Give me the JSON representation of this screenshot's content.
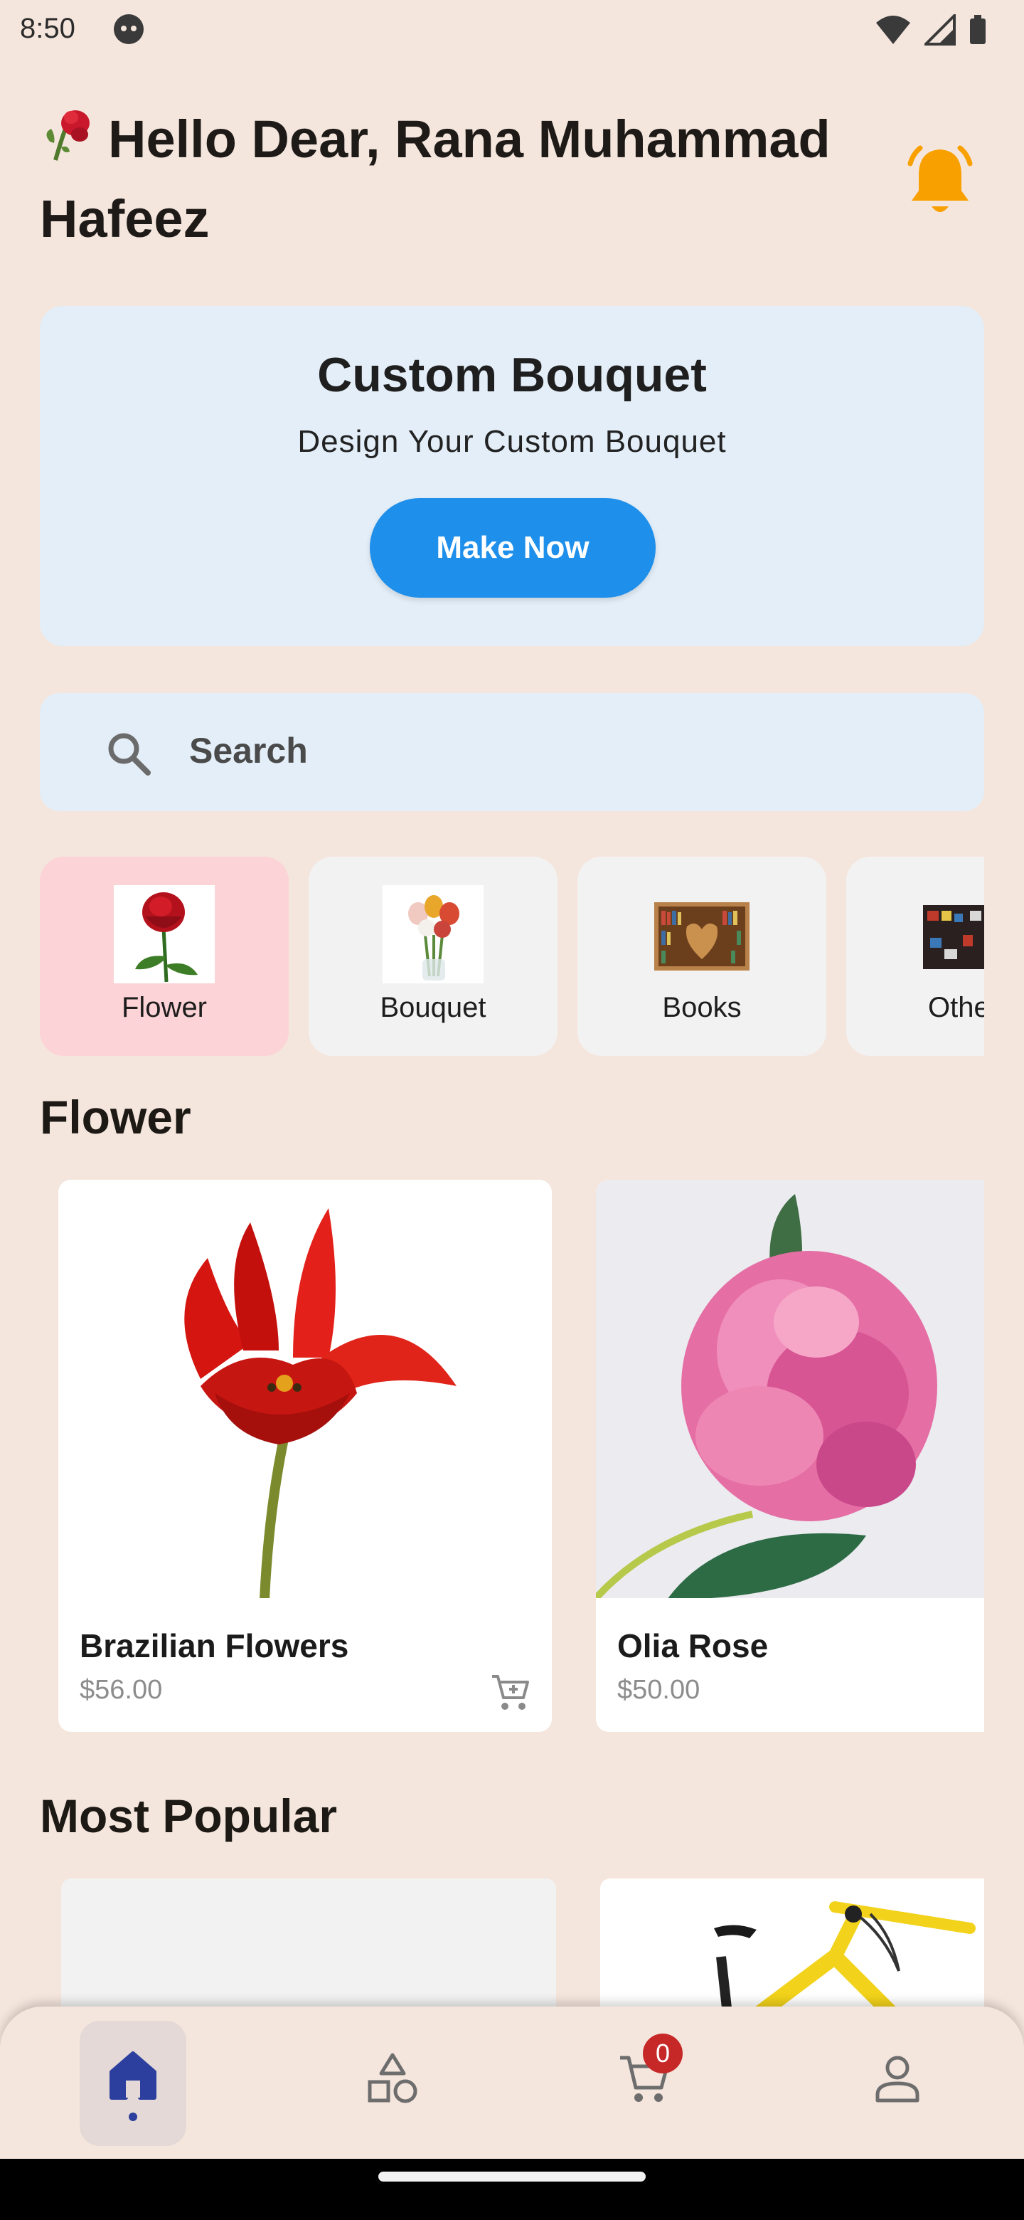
{
  "status_bar": {
    "time": "8:50"
  },
  "header": {
    "greeting": "Hello Dear, Rana Muhammad Hafeez"
  },
  "custom_bouquet": {
    "title": "Custom Bouquet",
    "subtitle": "Design Your Custom Bouquet",
    "button_label": "Make Now"
  },
  "search": {
    "placeholder": "Search"
  },
  "categories": [
    {
      "label": "Flower",
      "selected": true
    },
    {
      "label": "Bouquet",
      "selected": false
    },
    {
      "label": "Books",
      "selected": false
    },
    {
      "label": "Others",
      "selected": false
    }
  ],
  "flower_section": {
    "title": "Flower",
    "products": [
      {
        "name": "Brazilian Flowers",
        "price": "$56.00"
      },
      {
        "name": "Olia Rose",
        "price": "$50.00"
      }
    ]
  },
  "popular_section": {
    "title": "Most Popular"
  },
  "bottom_nav": {
    "items": [
      "home",
      "categories",
      "cart",
      "profile"
    ],
    "cart_count": "0"
  },
  "colors": {
    "background": "#F5E6DD",
    "accent_blue": "#1E8FEA",
    "card_blue": "#E3EEF8",
    "category_selected": "#FCD3D6",
    "bell": "#F7A000",
    "badge": "#C62828"
  }
}
